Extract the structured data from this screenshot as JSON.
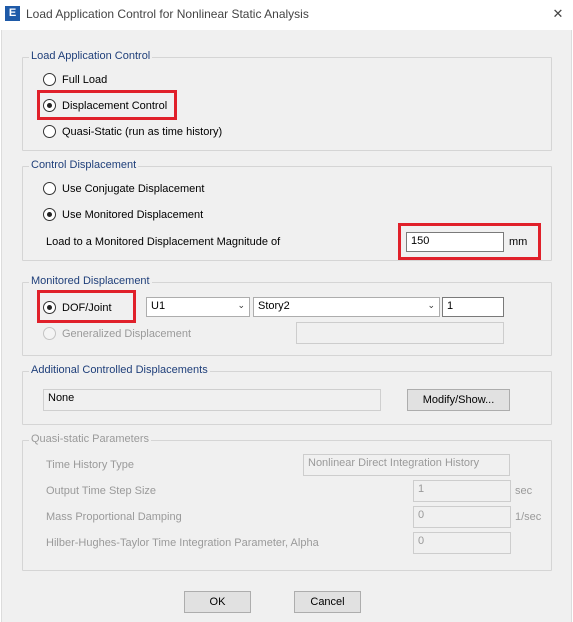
{
  "window": {
    "app_icon": "E",
    "title": "Load Application Control for Nonlinear Static Analysis",
    "close_glyph": "✕"
  },
  "load_application_control": {
    "legend": "Load Application Control",
    "options": [
      "Full Load",
      "Displacement Control",
      "Quasi-Static (run as time history)"
    ],
    "selected": "Displacement Control"
  },
  "control_displacement": {
    "legend": "Control Displacement",
    "options": [
      "Use Conjugate Displacement",
      "Use Monitored Displacement"
    ],
    "selected": "Use Monitored Displacement",
    "magnitude_label": "Load to a Monitored Displacement Magnitude of",
    "magnitude_value": "150",
    "magnitude_unit": "mm"
  },
  "monitored_displacement": {
    "legend": "Monitored Displacement",
    "dof_label": "DOF/Joint",
    "dof_selected": true,
    "dof_value": "U1",
    "story_value": "Story2",
    "joint_value": "1",
    "generalized_label": "Generalized Displacement",
    "generalized_value": ""
  },
  "additional_controlled": {
    "legend": "Additional Controlled Displacements",
    "value": "None",
    "button_label": "Modify/Show..."
  },
  "quasi_static": {
    "legend": "Quasi-static Parameters",
    "time_history_type_label": "Time History Type",
    "time_history_type_value": "Nonlinear Direct Integration History",
    "output_step_label": "Output Time Step Size",
    "output_step_value": "1",
    "output_step_unit": "sec",
    "mass_damping_label": "Mass Proportional Damping",
    "mass_damping_value": "0",
    "mass_damping_unit": "1/sec",
    "hht_label": "Hilber-Hughes-Taylor Time Integration Parameter, Alpha",
    "hht_value": "0"
  },
  "footer": {
    "ok_label": "OK",
    "cancel_label": "Cancel"
  },
  "colors": {
    "highlight": "#e0202a",
    "legend_text": "#1f3f7a",
    "app_icon": "#1e5aa8"
  }
}
